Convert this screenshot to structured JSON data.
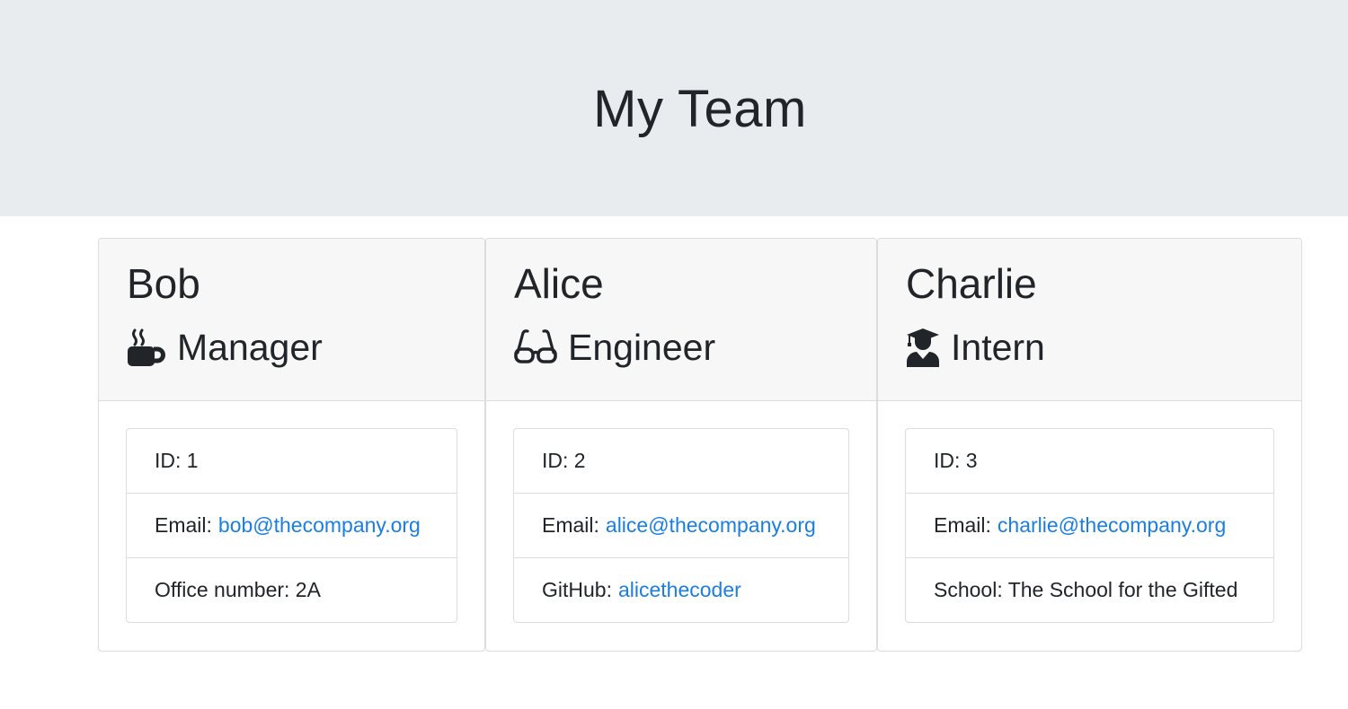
{
  "header": {
    "title": "My Team"
  },
  "cards": [
    {
      "name": "Bob",
      "role": "Manager",
      "role_icon": "coffee-icon",
      "id_label": "ID: 1",
      "email_label": "Email:",
      "email": "bob@thecompany.org",
      "extra_label": "Office number: 2A"
    },
    {
      "name": "Alice",
      "role": "Engineer",
      "role_icon": "glasses-icon",
      "id_label": "ID: 2",
      "email_label": "Email:",
      "email": "alice@thecompany.org",
      "extra_label": "GitHub:",
      "extra_link": "alicethecoder"
    },
    {
      "name": "Charlie",
      "role": "Intern",
      "role_icon": "graduate-icon",
      "id_label": "ID: 3",
      "email_label": "Email:",
      "email": "charlie@thecompany.org",
      "extra_label": "School: The School for the Gifted"
    }
  ],
  "colors": {
    "jumbotron_bg": "#e9ecef",
    "card_header_bg": "#f7f7f7",
    "link": "#1a7ee3",
    "text": "#212529"
  }
}
